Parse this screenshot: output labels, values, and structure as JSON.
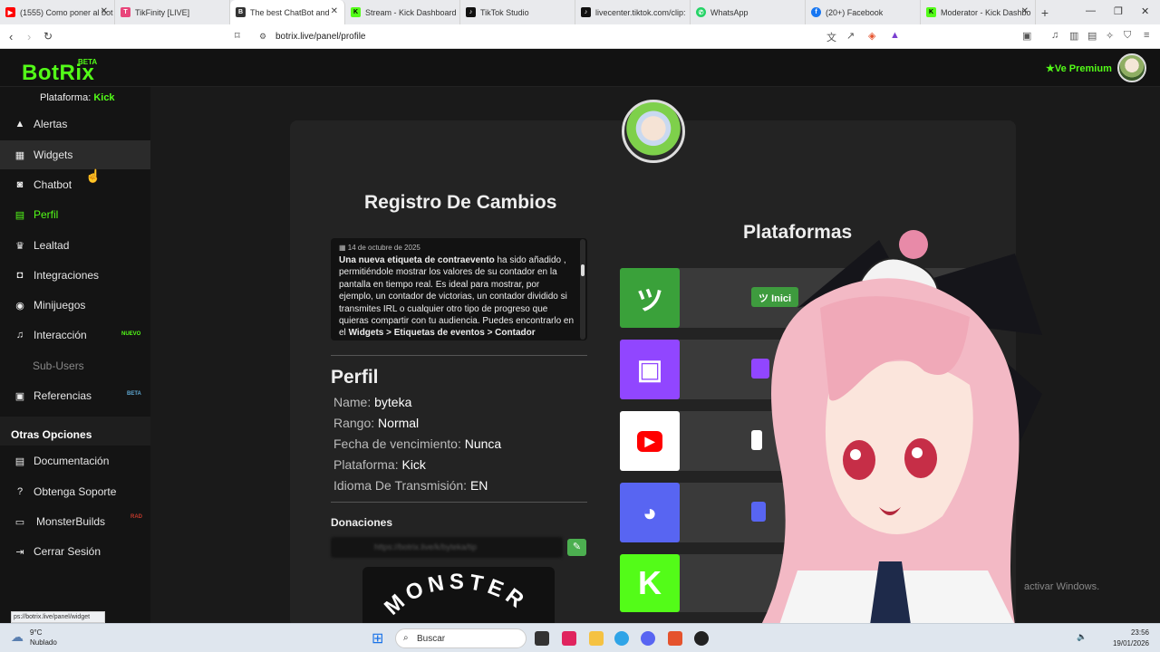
{
  "browser": {
    "tabs": [
      {
        "title": "(1555) Como poner al bot",
        "favicon_color": "#ff0000"
      },
      {
        "title": "TikFinity [LIVE]",
        "favicon_color": "#e8457a"
      },
      {
        "title": "The best ChatBot and",
        "favicon_color": "#333333",
        "active": true
      },
      {
        "title": "Stream - Kick Dashboard",
        "favicon_color": "#53fc18"
      },
      {
        "title": "TikTok Studio",
        "favicon_color": "#111111"
      },
      {
        "title": "livecenter.tiktok.com/clip:",
        "favicon_color": "#111111"
      },
      {
        "title": "WhatsApp",
        "favicon_color": "#25d366"
      },
      {
        "title": "(20+) Facebook",
        "favicon_color": "#1877f2"
      },
      {
        "title": "Moderator - Kick Dashbo",
        "favicon_color": "#53fc18"
      }
    ],
    "url": "botrix.live/panel/profile",
    "status_url": "ps://botrix.live/panel/widget"
  },
  "app": {
    "logo": "BotRix",
    "beta": "BETA",
    "premium": "Ve Premium",
    "platform_label": "Plataforma:",
    "platform_value": "Kick"
  },
  "sidebar": {
    "items": [
      {
        "label": "Alertas",
        "icon": "warning-icon"
      },
      {
        "label": "Widgets",
        "icon": "widgets-icon"
      },
      {
        "label": "Chatbot",
        "icon": "robot-icon"
      },
      {
        "label": "Perfil",
        "icon": "id-card-icon"
      },
      {
        "label": "Lealtad",
        "icon": "trophy-icon"
      },
      {
        "label": "Integraciones",
        "icon": "integrations-icon"
      },
      {
        "label": "Minijuegos",
        "icon": "gamepad-icon"
      },
      {
        "label": "Interacción",
        "icon": "music-icon",
        "tag": "NUEVO"
      },
      {
        "label": "Sub-Users",
        "icon": "users-icon"
      },
      {
        "label": "Referencias",
        "icon": "referral-icon",
        "tag": "BETA"
      }
    ],
    "other_title": "Otras Opciones",
    "other_items": [
      {
        "label": "Documentación",
        "icon": "docs-icon"
      },
      {
        "label": "Obtenga Soporte",
        "icon": "support-icon"
      },
      {
        "label": "MonsterBuilds",
        "icon": "monitor-icon",
        "tag": "RAD"
      },
      {
        "label": "Cerrar Sesión",
        "icon": "logout-icon"
      }
    ]
  },
  "changelog": {
    "title": "Registro De Cambios",
    "date": "14 de octubre de 2025",
    "bold_lead": "Una nueva etiqueta de contraevento",
    "text": " ha sido añadido , permitiéndole mostrar los valores de su contador en la pantalla en tiempo real. Es ideal para mostrar, por ejemplo, un contador de victorias, un contador dividido si transmites IRL o cualquier otro tipo de progreso que quieras compartir con tu audiencia. Puedes encontrarlo en el ",
    "path": "Widgets > Etiquetas de eventos > Contador"
  },
  "profile": {
    "title": "Perfil",
    "rows": [
      {
        "label": "Name:",
        "value": "byteka"
      },
      {
        "label": "Rango:",
        "value": "Normal"
      },
      {
        "label": "Fecha de vencimiento:",
        "value": "Nunca"
      },
      {
        "label": "Plataforma:",
        "value": "Kick"
      },
      {
        "label": "Idioma De Transmisión:",
        "value": "EN"
      }
    ],
    "donations_title": "Donaciones",
    "donations_url": "https://botrix.live/k/bytekа/tip",
    "monster_text": "MONSTER"
  },
  "platforms": {
    "title": "Plataformas",
    "items": [
      {
        "name": "kick-alt",
        "color": "#3aa13a",
        "button": "Inici"
      },
      {
        "name": "twitch",
        "color": "#9146ff"
      },
      {
        "name": "youtube",
        "color": "#ffffff"
      },
      {
        "name": "discord",
        "color": "#5865f2"
      },
      {
        "name": "kick",
        "color": "#53fc18"
      }
    ]
  },
  "watermark": "activar Windows.",
  "taskbar": {
    "weather_temp": "9°C",
    "weather_desc": "Nublado",
    "search": "Buscar",
    "time": "23:56",
    "date": "19/01/2026"
  }
}
